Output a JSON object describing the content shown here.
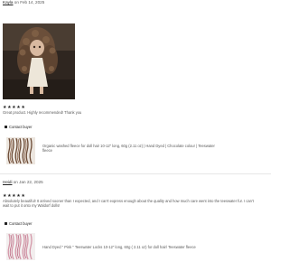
{
  "reviews": [
    {
      "reviewer": "Kayla",
      "date_prefix": "on",
      "date": "Feb 14, 2025",
      "rating": 5,
      "stars": "★★★★★",
      "text": "Great product. Highly recommended! Thank you",
      "contact_label": "Contact buyer",
      "item_title_1": "Organic washed fleece for doll hair 10-12\" long, 60g (2.11 oz) | Hand Dyed | Chocolate colour | Teeswater",
      "item_title_2": "fleece"
    },
    {
      "reviewer": "Heidi",
      "date_prefix": "on",
      "date": "Jan 22, 2025",
      "rating": 5,
      "stars": "★★★★★",
      "text_1": "Absolutely beautiful! It arrived sooner than I expected, and I can't express enough about the quality and how much care went into the teeswater fur. I can't",
      "text_2": "wait to put it onto my Waldorf dolls!",
      "contact_label": "Contact buyer",
      "item_title": "Hand Dyed \" Pink \" Teeswater Locks 10-12\" long, 60g ( 2.11 oz) for doll hair/ Teeswater fleece"
    }
  ]
}
